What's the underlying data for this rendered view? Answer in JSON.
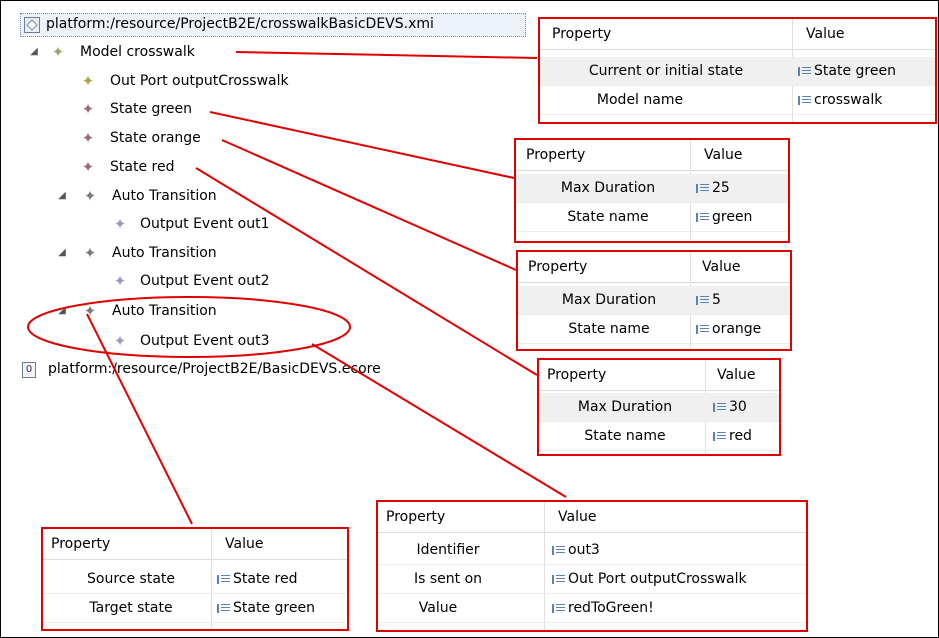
{
  "tree": {
    "root_path": "platform:/resource/ProjectB2E/crosswalkBasicDEVS.xmi",
    "items": [
      {
        "label": "Model crosswalk"
      },
      {
        "label": "Out Port outputCrosswalk"
      },
      {
        "label": "State green"
      },
      {
        "label": "State orange"
      },
      {
        "label": "State red"
      },
      {
        "label": "Auto Transition"
      },
      {
        "label": "Output Event out1"
      },
      {
        "label": "Auto Transition"
      },
      {
        "label": "Output Event out2"
      },
      {
        "label": "Auto Transition"
      },
      {
        "label": "Output Event out3"
      }
    ],
    "ecore_path": "platform:/resource/ProjectB2E/BasicDEVS.ecore"
  },
  "panels": {
    "model": {
      "col_property": "Property",
      "col_value": "Value",
      "rows": [
        {
          "property": "Current or initial state",
          "value": "State green"
        },
        {
          "property": "Model name",
          "value": "crosswalk"
        }
      ]
    },
    "green": {
      "col_property": "Property",
      "col_value": "Value",
      "rows": [
        {
          "property": "Max Duration",
          "value": "25"
        },
        {
          "property": "State name",
          "value": "green"
        }
      ]
    },
    "orange": {
      "col_property": "Property",
      "col_value": "Value",
      "rows": [
        {
          "property": "Max Duration",
          "value": "5"
        },
        {
          "property": "State name",
          "value": "orange"
        }
      ]
    },
    "red": {
      "col_property": "Property",
      "col_value": "Value",
      "rows": [
        {
          "property": "Max Duration",
          "value": "30"
        },
        {
          "property": "State name",
          "value": "red"
        }
      ]
    },
    "transition": {
      "col_property": "Property",
      "col_value": "Value",
      "rows": [
        {
          "property": "Source state",
          "value": "State red"
        },
        {
          "property": "Target state",
          "value": "State green"
        }
      ]
    },
    "event": {
      "col_property": "Property",
      "col_value": "Value",
      "rows": [
        {
          "property": "Identifier",
          "value": "out3"
        },
        {
          "property": "Is sent on",
          "value": "Out Port outputCrosswalk"
        },
        {
          "property": "Value",
          "value": "redToGreen!"
        }
      ]
    }
  },
  "colors": {
    "annotation": "#e00000",
    "selection": "#eef3fb"
  },
  "icons": {
    "root": "xmi-file-icon",
    "ecore": "ecore-file-icon",
    "expand": "expand-triangle-icon",
    "node": "model-element-icon",
    "value": "property-value-icon"
  }
}
